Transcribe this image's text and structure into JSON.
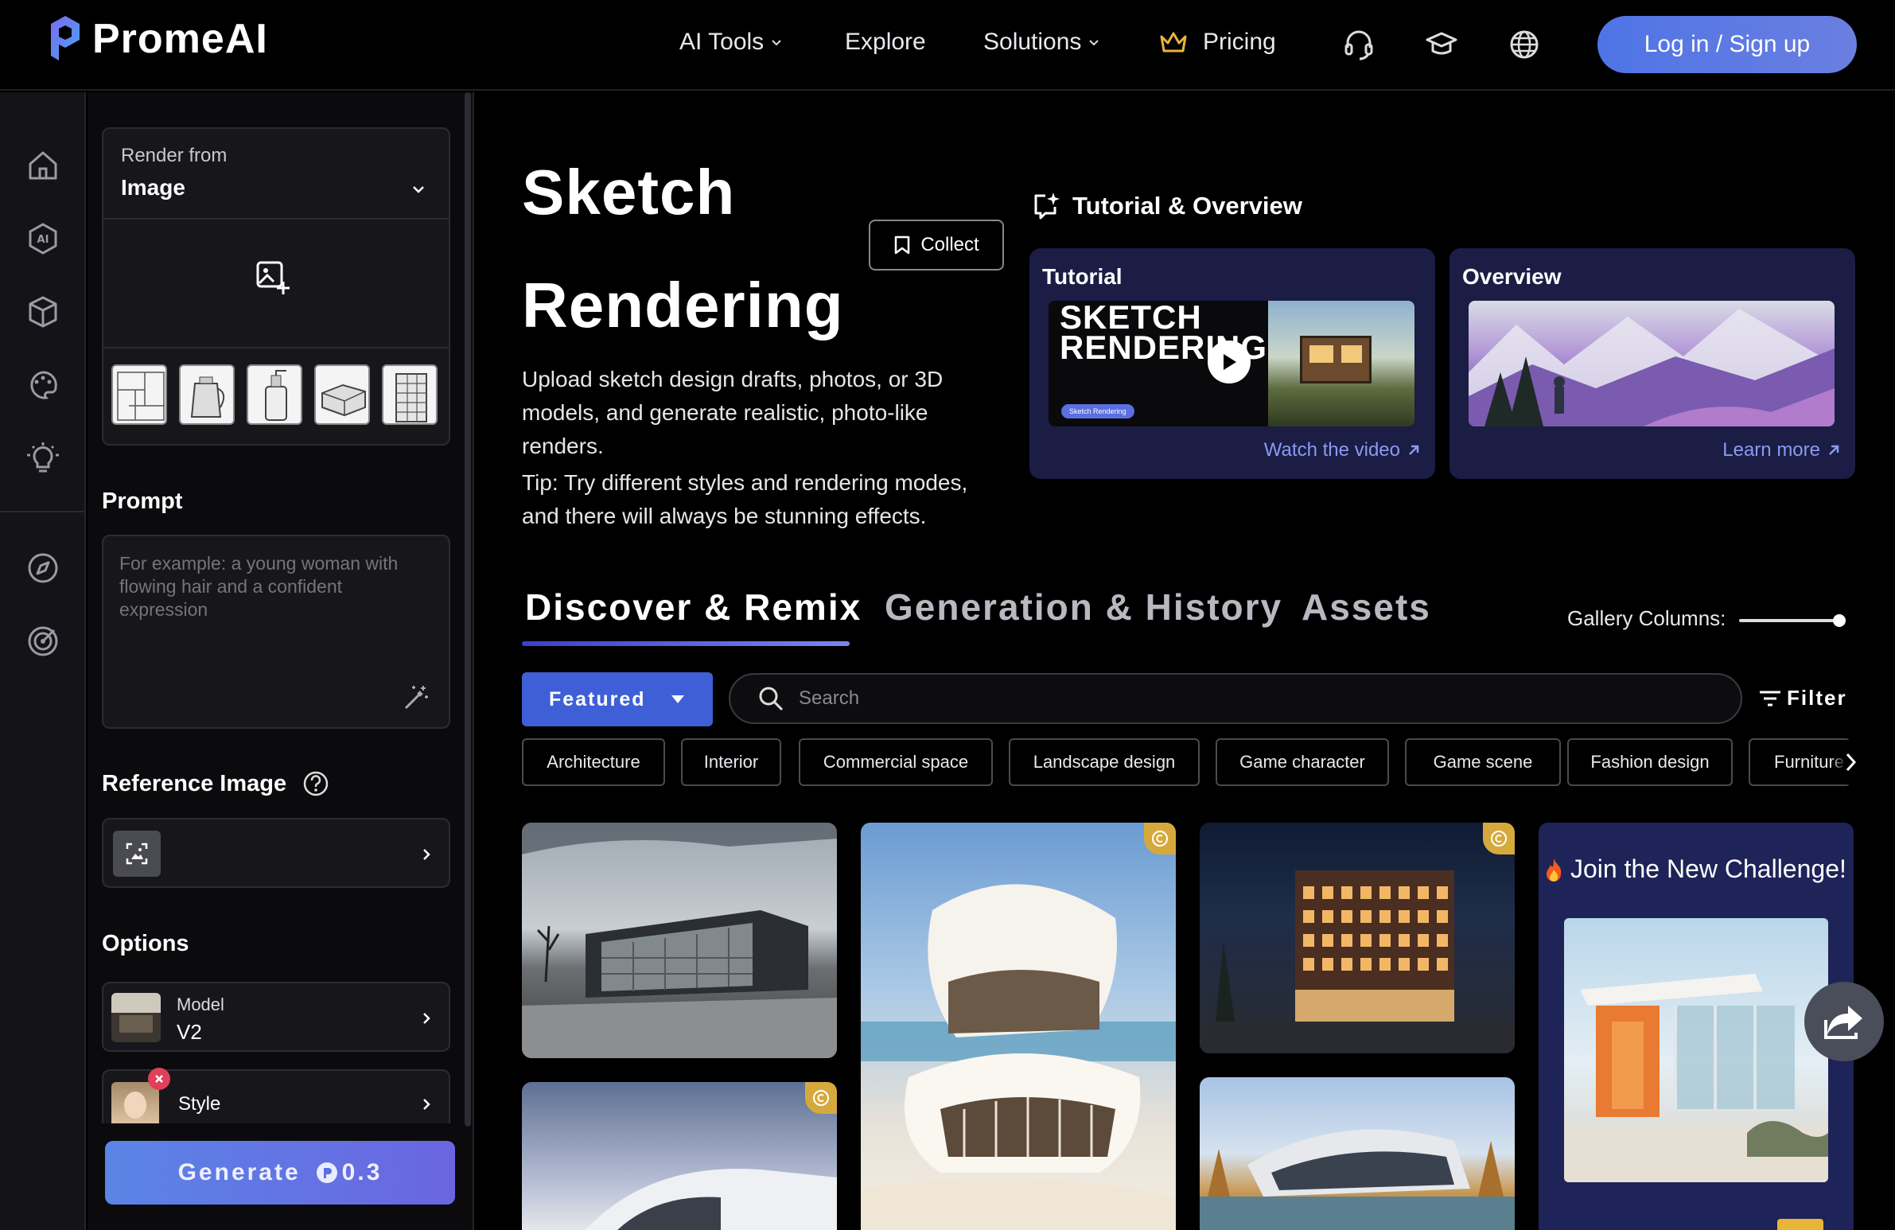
{
  "brand": {
    "name": "PromeAI"
  },
  "nav": {
    "ai_tools": "AI Tools",
    "explore": "Explore",
    "solutions": "Solutions",
    "pricing": "Pricing",
    "login": "Log in / Sign up"
  },
  "panel": {
    "render_from_label": "Render from",
    "render_from_value": "Image",
    "prompt_title": "Prompt",
    "prompt_placeholder": "For example: a young woman with flowing hair and a confident expression",
    "reference_title": "Reference Image",
    "options_title": "Options",
    "model_label": "Model",
    "model_value": "V2",
    "style_label": "Style",
    "generate_label": "Generate",
    "generate_cost": "0.3"
  },
  "hero": {
    "title_line1": "Sketch",
    "title_line2": "Rendering",
    "collect_label": "Collect",
    "description": "Upload sketch design drafts, photos, or 3D models, and generate realistic, photo-like renders.",
    "tip": "Tip: Try different styles and rendering modes, and there will always be stunning effects."
  },
  "tutorial": {
    "heading": "Tutorial & Overview",
    "tutorial_title": "Tutorial",
    "video_text_line1": "SKETCH",
    "video_text_line2": "RENDERING",
    "video_badge": "Sketch Rendering",
    "watch_link": "Watch the video",
    "overview_title": "Overview",
    "learn_link": "Learn more"
  },
  "tabs": {
    "discover": "Discover & Remix",
    "generation": "Generation & History",
    "assets": "Assets",
    "gallery_columns_label": "Gallery Columns:"
  },
  "filters": {
    "featured_label": "Featured",
    "search_placeholder": "Search",
    "filter_label": "Filter",
    "chips": [
      "Architecture",
      "Interior",
      "Commercial space",
      "Landscape design",
      "Game character",
      "Game scene",
      "Fashion design",
      "Furniture"
    ]
  },
  "gallery": {
    "challenge_title": "Join the New Challenge!"
  },
  "colors": {
    "accent": "#4f74e6",
    "tutorial_card": "#1b1d45",
    "challenge_card": "#1e2358",
    "coin": "#d6a93d"
  }
}
